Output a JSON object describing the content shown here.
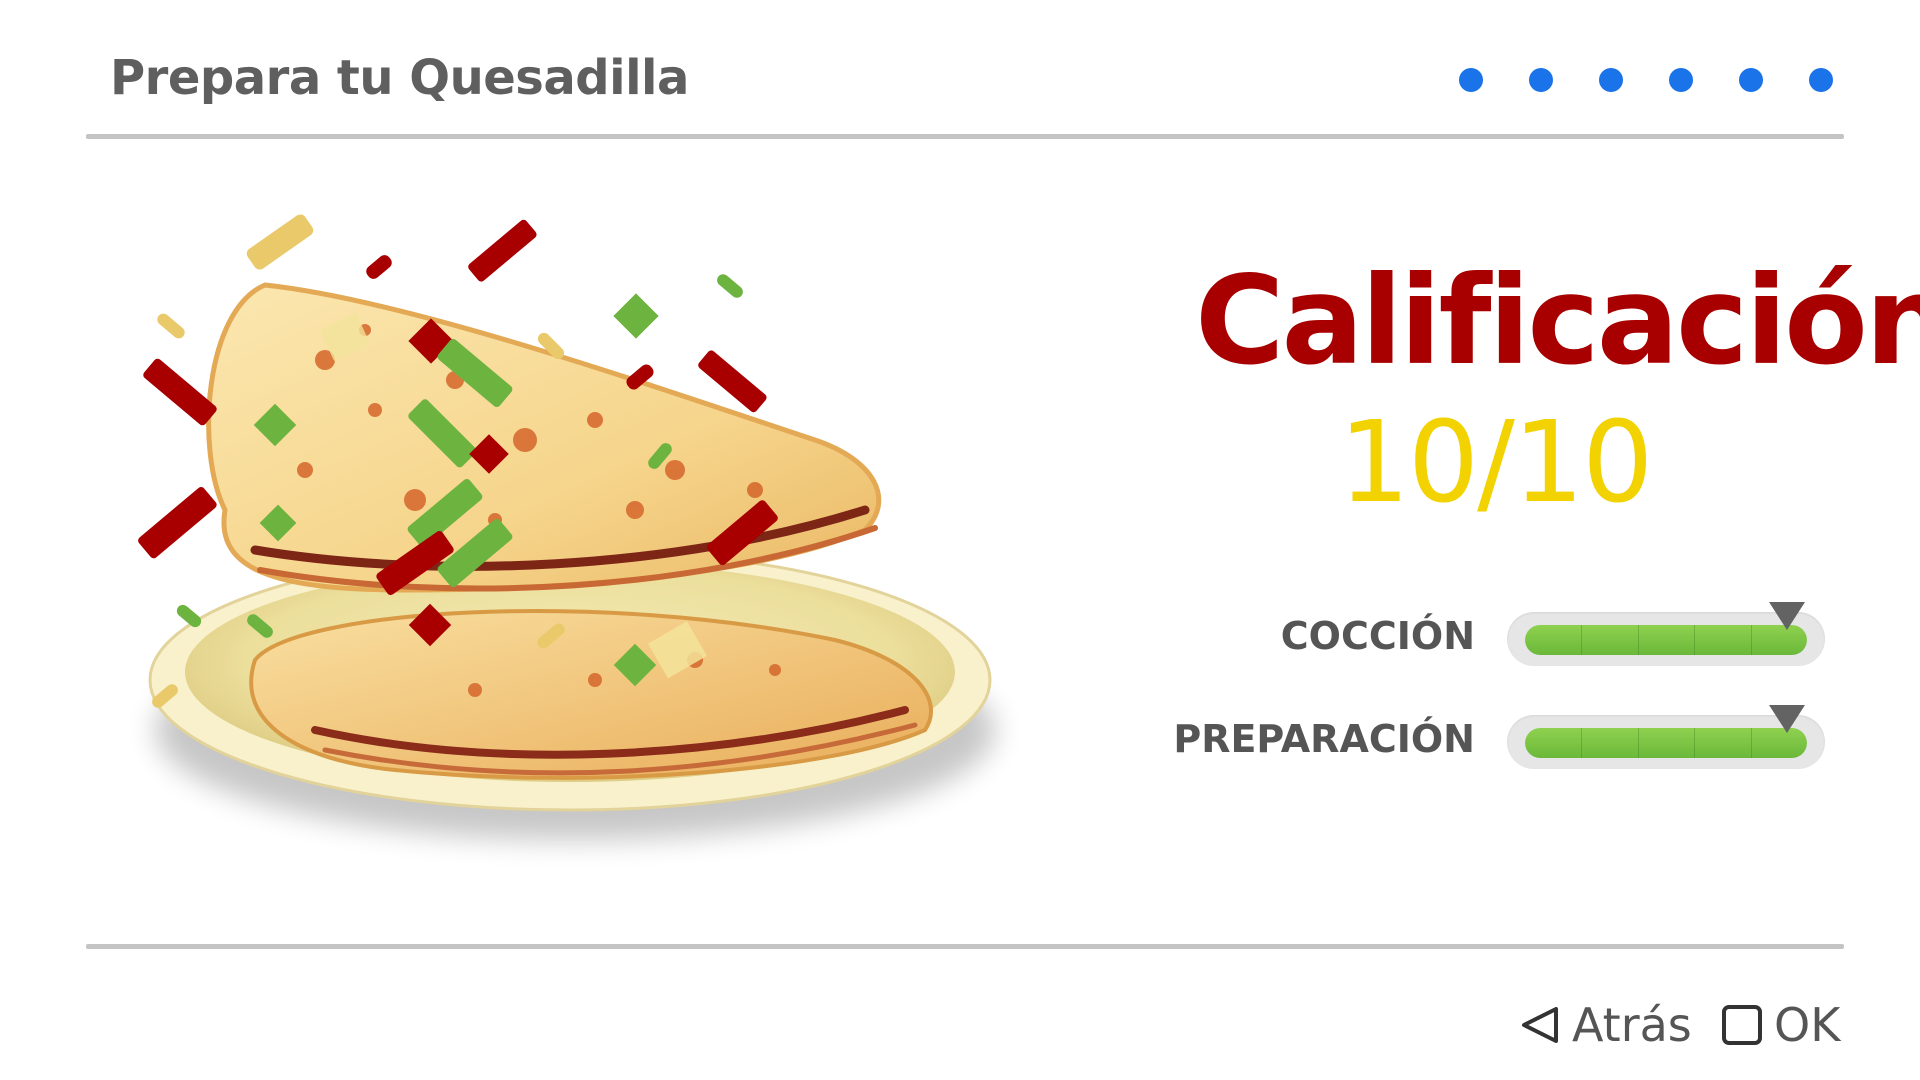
{
  "header": {
    "title": "Prepara tu Quesadilla",
    "progress_steps": 6,
    "progress_color": "#1a73e8"
  },
  "result": {
    "score_label": "Calificación",
    "score_value": "10/10",
    "score_label_color": "#a80000",
    "score_value_color": "#f2d200"
  },
  "stats": [
    {
      "label": "COCCIÓN",
      "level": 1.0,
      "target": 0.93
    },
    {
      "label": "PREPARACIÓN",
      "level": 1.0,
      "target": 0.93
    }
  ],
  "footer": {
    "back_label": "Atrás",
    "ok_label": "OK",
    "back_icon": "triangle-left-icon",
    "ok_icon": "square-button-icon"
  },
  "illustration": {
    "subject": "quesadilla-with-confetti-icon"
  }
}
